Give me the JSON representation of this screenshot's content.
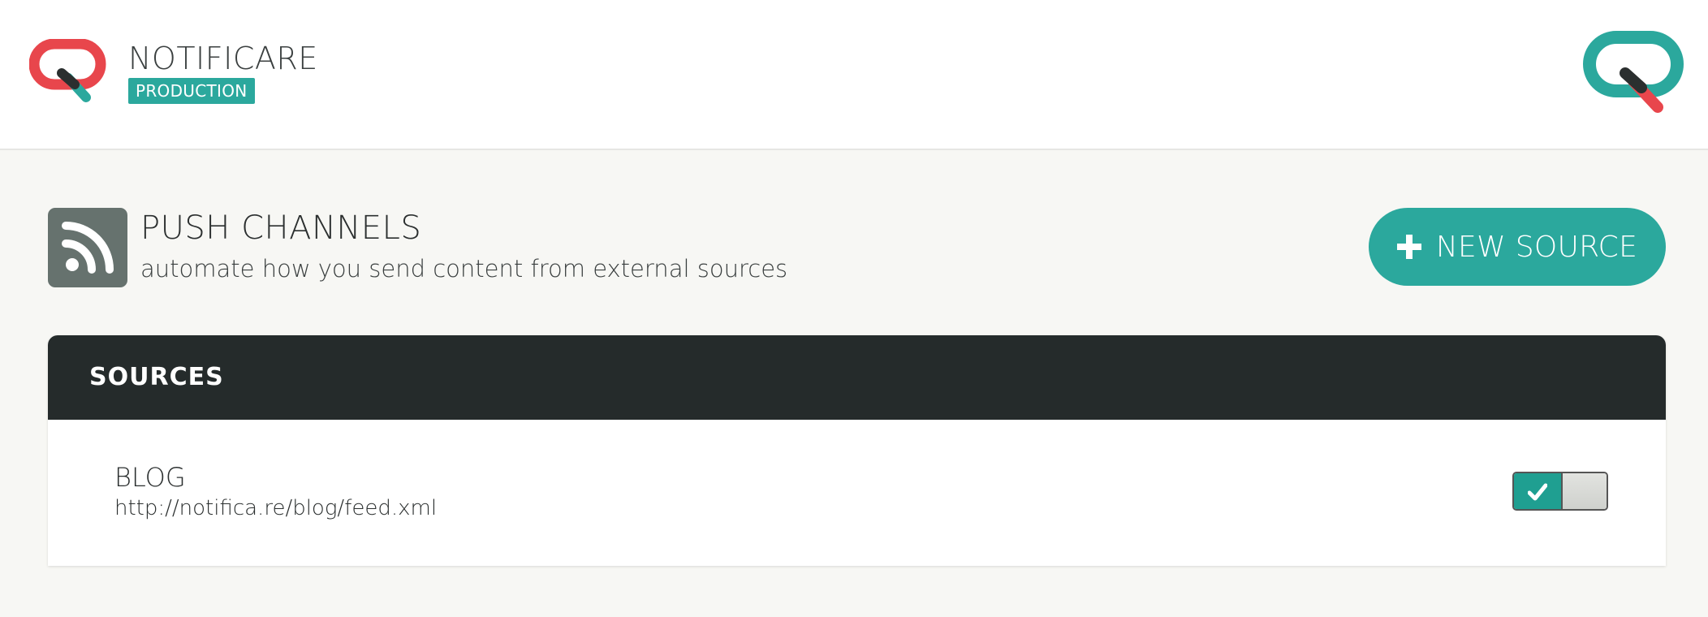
{
  "header": {
    "app_name": "NOTIFICARE",
    "environment": "PRODUCTION"
  },
  "page": {
    "title": "PUSH CHANNELS",
    "subtitle": "automate how you send content from external sources",
    "icon": "rss-icon",
    "new_source_label": "NEW SOURCE"
  },
  "sources": {
    "title": "SOURCES",
    "items": [
      {
        "name": "BLOG",
        "url": "http://notifica.re/blog/feed.xml",
        "enabled": true
      }
    ]
  },
  "colors": {
    "accent": "#2ba89d",
    "logo_red": "#e8464c",
    "header_dark": "#252b2b",
    "icon_bg": "#66726e"
  }
}
